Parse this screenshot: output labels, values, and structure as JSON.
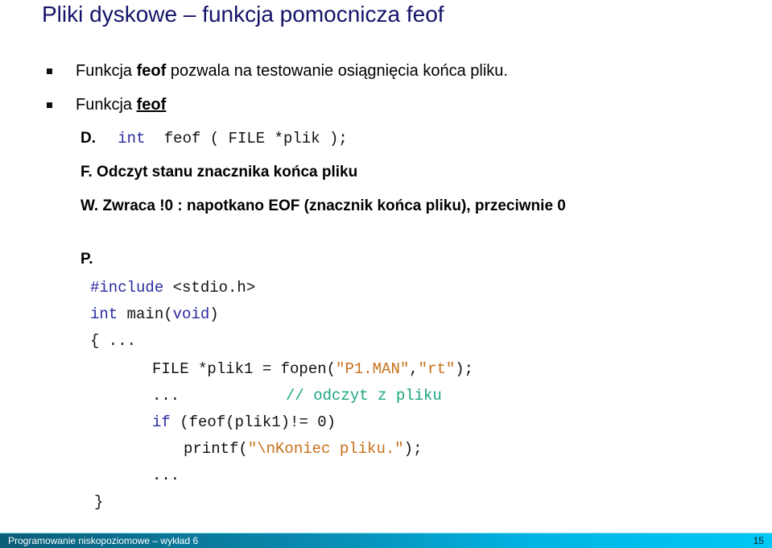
{
  "title": "Pliki dyskowe – funkcja pomocnicza feof",
  "bullets": [
    {
      "icon": "square-bullet-icon",
      "prefix": "Funkcja ",
      "bold": "feof",
      "suffix": " pozwala na testowanie osiągnięcia końca pliku."
    },
    {
      "icon": "square-bullet-icon",
      "prefix": "Funkcja ",
      "bold_underlined": "feof"
    }
  ],
  "declaration": {
    "label": "D.",
    "keyword": "int",
    "rest": "feof ( FILE *plik );"
  },
  "function_desc": "F. Odczyt stanu znacznika końca pliku",
  "returns": "W. Zwraca !0 : napotkano EOF (znacznik końca pliku), przeciwnie 0",
  "example_label": "P.",
  "code": {
    "include_kw": "#include",
    "include_rest": " <stdio.h>",
    "main_kw": "int",
    "main_mid": " main(",
    "main_void": "void",
    "main_end": ")",
    "open_brace": "{ ...",
    "fopen_pre": "FILE *plik1 = fopen(",
    "fopen_str1": "\"P1.MAN\"",
    "fopen_comma": ",",
    "fopen_str2": "\"rt\"",
    "fopen_end": ");",
    "ellipsis1": "...",
    "comment": "// odczyt z pliku",
    "if_kw": "if",
    "if_rest": " (feof(plik1)!= 0)",
    "printf_pre": "printf(",
    "printf_str": "\"\\nKoniec pliku.\"",
    "printf_end": ");",
    "ellipsis2": "...",
    "close_brace": "}"
  },
  "colors": {
    "title": "#14146a",
    "keyword": "#2a2aa0",
    "string": "#c8701a",
    "comment": "#1aa57f",
    "footer_gradient_start": "#0a5d78",
    "footer_gradient_end": "#00c8f6"
  },
  "footer": {
    "course": "Programowanie niskopoziomowe – wykład 6",
    "page_number": "15"
  }
}
